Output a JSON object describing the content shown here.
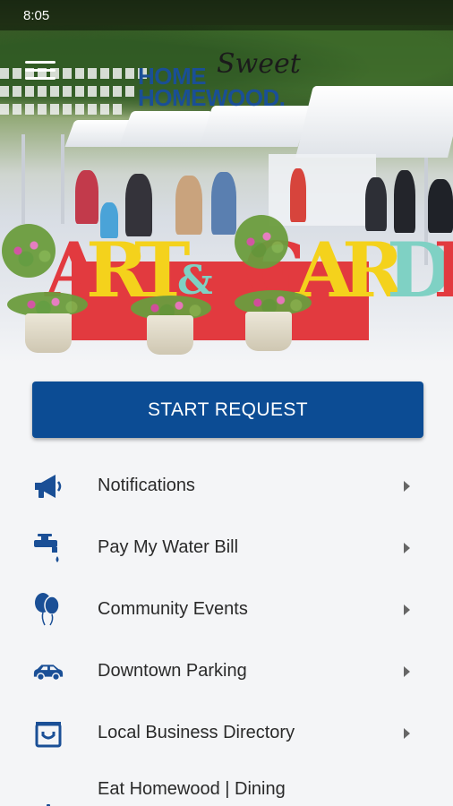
{
  "status_bar": {
    "time": "8:05"
  },
  "logo": {
    "home": "HOME",
    "sweet": "Sweet",
    "homewood": "HOMEWOOD."
  },
  "hero": {
    "sign_letters": [
      "A",
      "R",
      "T",
      "&",
      "G",
      "A",
      "R",
      "D",
      "E"
    ]
  },
  "start_button": {
    "label": "START REQUEST"
  },
  "menu": {
    "items": [
      {
        "label": "Notifications",
        "icon": "megaphone-icon"
      },
      {
        "label": "Pay My Water Bill",
        "icon": "water-faucet-icon"
      },
      {
        "label": "Community Events",
        "icon": "balloons-icon"
      },
      {
        "label": "Downtown Parking",
        "icon": "car-icon"
      },
      {
        "label": "Local Business Directory",
        "icon": "shopping-bag-icon"
      },
      {
        "label": "Eat Homewood | Dining",
        "icon": "dining-cloche-icon"
      }
    ]
  },
  "colors": {
    "brand_blue": "#0c4c94",
    "icon_blue": "#1a4f96",
    "sign_red": "#e23a3f",
    "sign_yellow": "#f4d21c",
    "sign_teal": "#7fd1c4"
  }
}
